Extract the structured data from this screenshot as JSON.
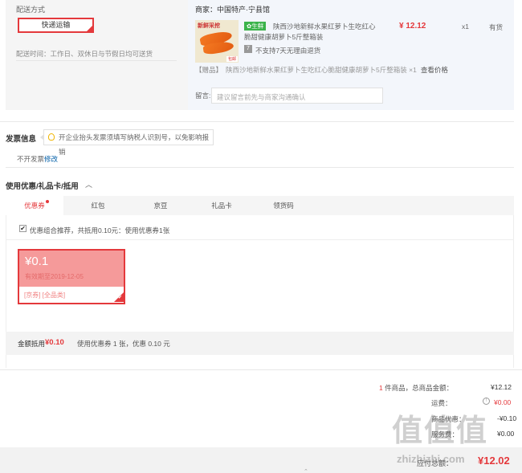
{
  "shipping": {
    "title": "配送方式",
    "method": "快递运输",
    "note": "配送时间：工作日、双休日与节假日均可送货"
  },
  "goods": {
    "shop_name": "商家：中国特产·宁县馆",
    "image_label": "新鲜采挖",
    "image_tag": "包邮",
    "fresh_tag": "生鲜",
    "title": "陕西沙地新鲜水果红萝卜生吃红心脆甜健康胡萝卜5斤整箱装",
    "price": "¥ 12.12",
    "qty": "x1",
    "stock": "有货",
    "no_return": "不支持7天无理由退货",
    "gift_prefix": "【赠品】",
    "gift_name": "陕西沙地新鲜水果红萝卜生吃红心脆甜健康胡萝卜5斤整箱装 ×1",
    "see_price": "查看价格",
    "msg_label": "留言:",
    "msg_placeholder": "建议留言前先与商家沟通确认"
  },
  "invoice": {
    "title": "发票信息",
    "tip": "开企业抬头发票须填写纳税人识别号，以免影响报销",
    "value": "不开发票",
    "edit": "修改"
  },
  "coupon": {
    "title": "使用优惠/礼品卡/抵用",
    "tabs": [
      "优惠券",
      "红包",
      "京豆",
      "礼品卡",
      "领货码"
    ],
    "combo_text": "优惠组合推荐，共抵用0.10元：使用优惠券1张",
    "card_amount": "¥0.1",
    "card_expire": "有效期至2019-12-05",
    "card_scope": "[京券]  [全品类]",
    "deduct_label": "金额抵用",
    "deduct_value": "¥0.10",
    "deduct_detail": "使用优惠券 1 张，优惠 0.10 元"
  },
  "summary": {
    "count_num": "1",
    "count_text": " 件商品，总商品金额：",
    "total": "¥12.12",
    "ship_label": "运费：",
    "ship_fee": "¥0.00",
    "row3_label": "商品优惠：",
    "row3_val": "-¥0.10",
    "row4_label": "服务费：",
    "row4_val": "¥0.00",
    "pay_label": "应付总额：",
    "pay_amount": "¥12.02"
  },
  "watermark": {
    "main": "值值值",
    "sub": "zhizhizhi.com"
  },
  "colors": {
    "accent": "#e4393c",
    "link": "#005ea7",
    "fresh": "#3bb34a"
  }
}
